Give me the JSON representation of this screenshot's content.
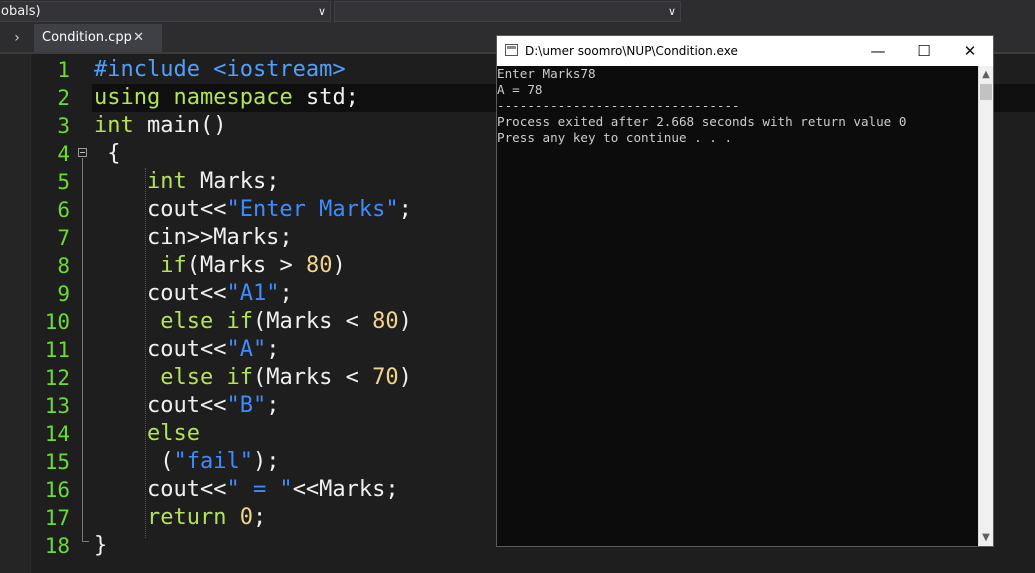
{
  "toolbar": {
    "scope_combo": "obals)",
    "function_combo": ""
  },
  "tabs": {
    "scroll_arrow": "›",
    "active_tab": "Condition.cpp",
    "close_glyph": "✕"
  },
  "editor": {
    "current_line": 2,
    "lines": [
      {
        "n": "1",
        "tokens": [
          [
            "pre",
            "#include <iostream>"
          ]
        ]
      },
      {
        "n": "2",
        "tokens": [
          [
            "kw",
            "using"
          ],
          [
            "pl",
            " "
          ],
          [
            "kw",
            "namespace"
          ],
          [
            "pl",
            " std;"
          ]
        ]
      },
      {
        "n": "3",
        "tokens": [
          [
            "kw",
            "int"
          ],
          [
            "pl",
            " main()"
          ]
        ]
      },
      {
        "n": "4",
        "tokens": [
          [
            "pl",
            " {"
          ]
        ]
      },
      {
        "n": "5",
        "tokens": [
          [
            "pl",
            "    "
          ],
          [
            "kw",
            "int"
          ],
          [
            "pl",
            " Marks;"
          ]
        ]
      },
      {
        "n": "6",
        "tokens": [
          [
            "pl",
            "    cout<<"
          ],
          [
            "str",
            "\"Enter Marks\""
          ],
          [
            "pl",
            ";"
          ]
        ]
      },
      {
        "n": "7",
        "tokens": [
          [
            "pl",
            "    cin>>Marks;"
          ]
        ]
      },
      {
        "n": "8",
        "tokens": [
          [
            "pl",
            "     "
          ],
          [
            "kw",
            "if"
          ],
          [
            "pl",
            "(Marks > "
          ],
          [
            "num",
            "80"
          ],
          [
            "pl",
            ")"
          ]
        ]
      },
      {
        "n": "9",
        "tokens": [
          [
            "pl",
            "    cout<<"
          ],
          [
            "str",
            "\"A1\""
          ],
          [
            "pl",
            ";"
          ]
        ]
      },
      {
        "n": "10",
        "tokens": [
          [
            "pl",
            "     "
          ],
          [
            "kw",
            "else if"
          ],
          [
            "pl",
            "(Marks < "
          ],
          [
            "num",
            "80"
          ],
          [
            "pl",
            ")"
          ]
        ]
      },
      {
        "n": "11",
        "tokens": [
          [
            "pl",
            "    cout<<"
          ],
          [
            "str",
            "\"A\""
          ],
          [
            "pl",
            ";"
          ]
        ]
      },
      {
        "n": "12",
        "tokens": [
          [
            "pl",
            "     "
          ],
          [
            "kw",
            "else if"
          ],
          [
            "pl",
            "(Marks < "
          ],
          [
            "num",
            "70"
          ],
          [
            "pl",
            ")"
          ]
        ]
      },
      {
        "n": "13",
        "tokens": [
          [
            "pl",
            "    cout<<"
          ],
          [
            "str",
            "\"B\""
          ],
          [
            "pl",
            ";"
          ]
        ]
      },
      {
        "n": "14",
        "tokens": [
          [
            "pl",
            "    "
          ],
          [
            "kw",
            "else"
          ]
        ]
      },
      {
        "n": "15",
        "tokens": [
          [
            "pl",
            "     ("
          ],
          [
            "str",
            "\"fail\""
          ],
          [
            "pl",
            ");"
          ]
        ]
      },
      {
        "n": "16",
        "tokens": [
          [
            "pl",
            "    cout<<"
          ],
          [
            "str",
            "\" = \""
          ],
          [
            "pl",
            "<<Marks;"
          ]
        ]
      },
      {
        "n": "17",
        "tokens": [
          [
            "pl",
            "    "
          ],
          [
            "kw",
            "return"
          ],
          [
            "pl",
            " "
          ],
          [
            "num",
            "0"
          ],
          [
            "pl",
            ";"
          ]
        ]
      },
      {
        "n": "18",
        "tokens": [
          [
            "pl",
            "}"
          ]
        ]
      }
    ]
  },
  "console": {
    "title": "D:\\umer soomro\\NUP\\Condition.exe",
    "minimize": "—",
    "maximize": "☐",
    "close": "✕",
    "output": [
      "Enter Marks78",
      "A = 78",
      "--------------------------------",
      "Process exited after 2.668 seconds with return value 0",
      "Press any key to continue . . ."
    ],
    "scroll_up": "▲",
    "scroll_down": "▼"
  },
  "colors": {
    "line_number": "#6bdc2f",
    "keyword": "#b4e354",
    "preprocessor": "#4ea0ff",
    "string": "#3d8cff",
    "number": "#f0d58c",
    "editor_bg": "#1e1e1e",
    "console_bg": "#0c0c0c"
  }
}
